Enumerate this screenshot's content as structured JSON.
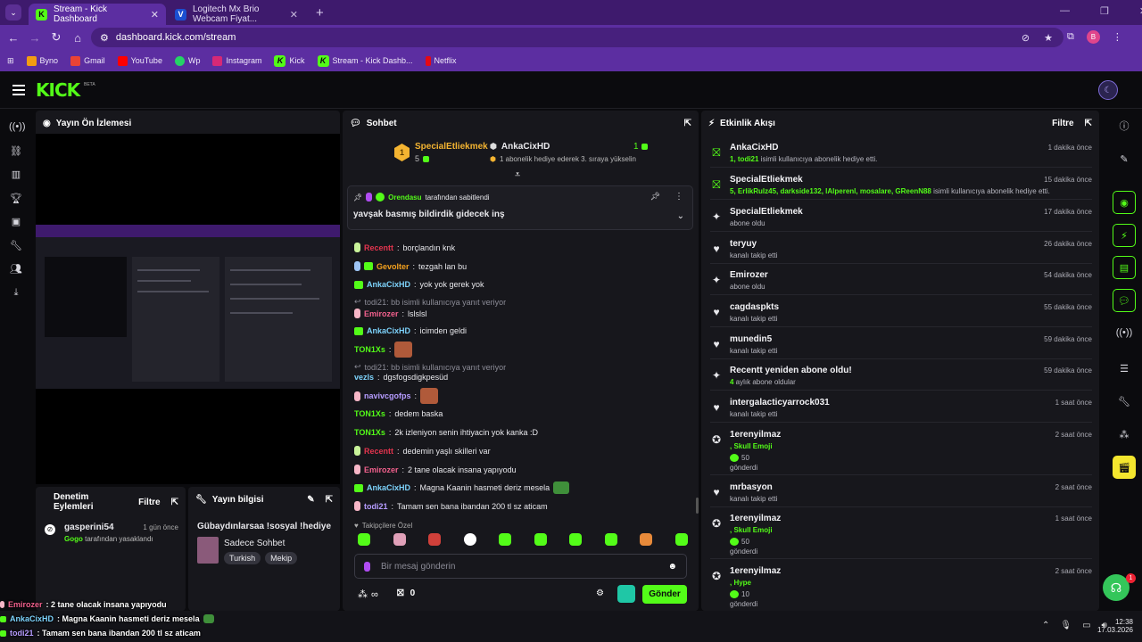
{
  "browser": {
    "tabs": [
      {
        "label": "Stream - Kick Dashboard",
        "active": true
      },
      {
        "label": "Logitech Mx Brio Webcam Fiyat...",
        "active": false
      }
    ],
    "new_tab": "+",
    "url": "dashboard.kick.com/stream",
    "profile_initial": "B",
    "bookmarks": [
      "Byno",
      "Gmail",
      "YouTube",
      "Wp",
      "Instagram",
      "Kick",
      "Stream - Kick Dashb...",
      "Netflix"
    ]
  },
  "header": {
    "logo": "KICK",
    "beta": "BETA"
  },
  "preview": {
    "title": "Yayın Ön İzlemesi"
  },
  "mod": {
    "title_line1": "Denetim",
    "title_line2": "Eylemleri",
    "filter": "Filtre",
    "entry_user": "gasperini54",
    "entry_time": "1 gün önce",
    "entry_actor": "Gogo",
    "entry_desc": "tarafından yasaklandı"
  },
  "streaminfo": {
    "title": "Yayın bilgisi",
    "stream_title": "Gübaydınlarsaa !sosyal !hediye",
    "category": "Sadece Sohbet",
    "tags": [
      "Turkish",
      "Mekip"
    ]
  },
  "chat": {
    "title": "Sohbet",
    "top_gifter": {
      "rank": "1",
      "name": "SpecialEtliekmek",
      "count": "5"
    },
    "sub_user": "AnkaCixHD",
    "sub_count": "1",
    "sub_desc": "1 abonelik hediye ederek 3. sıraya yükselin",
    "pinned": {
      "by": "Orendasu",
      "by_suffix": "tarafından sabitlendi",
      "text": "yavşak basmış bildirdik gidecek inş"
    },
    "messages": [
      {
        "user": "Recentt",
        "text": "borçlandın knk",
        "color": "#e3344e"
      },
      {
        "user": "Gevolter",
        "text": "tezgah lan bu",
        "color": "#f4a11e"
      },
      {
        "user": "AnkaCixHD",
        "text": "yok yok gerek yok",
        "color": "#7dd3fc"
      },
      {
        "reply": "todi21: bb isimli kullanıcıya yanıt veriyor"
      },
      {
        "user": "Emirozer",
        "text": "lslslsl",
        "color": "#f0608c"
      },
      {
        "user": "AnkaCixHD",
        "text": "icimden geldi",
        "color": "#7dd3fc"
      },
      {
        "user": "TON1Xs",
        "text": "",
        "color": "#53fc18"
      },
      {
        "reply": "todi21: bb isimli kullanıcıya yanıt veriyor"
      },
      {
        "user": "vezls",
        "text": "dgsfogsdigkpesüd",
        "color": "#7dd3fc"
      },
      {
        "user": "navivcgofps",
        "text": "",
        "color": "#b69cff"
      },
      {
        "user": "TON1Xs",
        "text": "dedem baska",
        "color": "#53fc18"
      },
      {
        "user": "TON1Xs",
        "text": "2k izleniyon senin ihtiyacin yok kanka :D",
        "color": "#53fc18"
      },
      {
        "user": "Recentt",
        "text": "dedemin yaşlı skilleri var",
        "color": "#e3344e"
      },
      {
        "user": "Emirozer",
        "text": "2 tane olacak insana yapıyodu",
        "color": "#f0608c"
      },
      {
        "user": "AnkaCixHD",
        "text": "Magna Kaanin hasmeti deriz mesela",
        "color": "#7dd3fc"
      },
      {
        "user": "todi21",
        "text": "Tamam sen bana ibandan 200 tl sz aticam",
        "color": "#b69cff"
      }
    ],
    "followers_label": "Takipçilere Özel",
    "input_placeholder": "Bir mesaj gönderin",
    "points": "∞",
    "gift_count": "0",
    "send": "Gönder"
  },
  "activity": {
    "title": "Etkinlik Akışı",
    "filter": "Filtre",
    "items": [
      {
        "name": "AnkaCixHD",
        "time": "1 dakika önce",
        "hl": "1, todi21",
        "desc": " isimli kullanıcıya abonelik hediye etti.",
        "icon": "gift"
      },
      {
        "name": "SpecialEtliekmek",
        "time": "15 dakika önce",
        "hl": "5, ErlikRulz45, darkside132, lAlperenl, mosalare, GReenN88",
        "desc": " isimli kullanıcıya abonelik hediye etti.",
        "icon": "gift"
      },
      {
        "name": "SpecialEtliekmek",
        "time": "17 dakika önce",
        "hl": "",
        "desc": "abone oldu",
        "icon": "star"
      },
      {
        "name": "teryuy",
        "time": "26 dakika önce",
        "hl": "",
        "desc": "kanalı takip etti",
        "icon": "heart"
      },
      {
        "name": "Emirozer",
        "time": "54 dakika önce",
        "hl": "",
        "desc": "abone oldu",
        "icon": "star"
      },
      {
        "name": "cagdaspkts",
        "time": "55 dakika önce",
        "hl": "",
        "desc": "kanalı takip etti",
        "icon": "heart"
      },
      {
        "name": "munedin5",
        "time": "59 dakika önce",
        "hl": "",
        "desc": "kanalı takip etti",
        "icon": "heart"
      },
      {
        "name": "Recentt yeniden abone oldu!",
        "time": "59 dakika önce",
        "hl": "4",
        "desc": " aylık abone oldular",
        "icon": "star"
      },
      {
        "name": "intergalacticyarrock031",
        "time": "1 saat önce",
        "hl": "",
        "desc": "kanalı takip etti",
        "icon": "heart"
      },
      {
        "name": "1erenyilmaz",
        "time": "2 saat önce",
        "hl": ", Skull Emoji",
        "desc": "",
        "amount": "50",
        "sent": "gönderdi",
        "icon": "kicks"
      },
      {
        "name": "mrbasyon",
        "time": "2 saat önce",
        "hl": "",
        "desc": "kanalı takip etti",
        "icon": "heart"
      },
      {
        "name": "1erenyilmaz",
        "time": "1 saat önce",
        "hl": ", Skull Emoji",
        "desc": "",
        "amount": "50",
        "sent": "gönderdi",
        "icon": "kicks"
      },
      {
        "name": "1erenyilmaz",
        "time": "2 saat önce",
        "hl": ", Hype",
        "desc": "",
        "amount": "10",
        "sent": "gönderdi",
        "icon": "kicks"
      }
    ]
  },
  "overlay": [
    {
      "user": "Emirozer",
      "text": ": 2 tane olacak insana yapıyodu",
      "color": "#f0608c"
    },
    {
      "user": "AnkaCixHD",
      "text": ": Magna Kaanin hasmeti deriz mesela",
      "color": "#7dd3fc"
    },
    {
      "user": "todi21",
      "text": ": Tamam sen bana ibandan 200 tl sz aticam",
      "color": "#b69cff"
    }
  ],
  "taskbar": {
    "time": "12:38",
    "date": "17.03.2026"
  },
  "notif_count": "1",
  "colors": {
    "accent": "#53fc18",
    "chrome": "#5c2ea1",
    "bg": "#0b0b0e",
    "panel": "#17171c"
  }
}
